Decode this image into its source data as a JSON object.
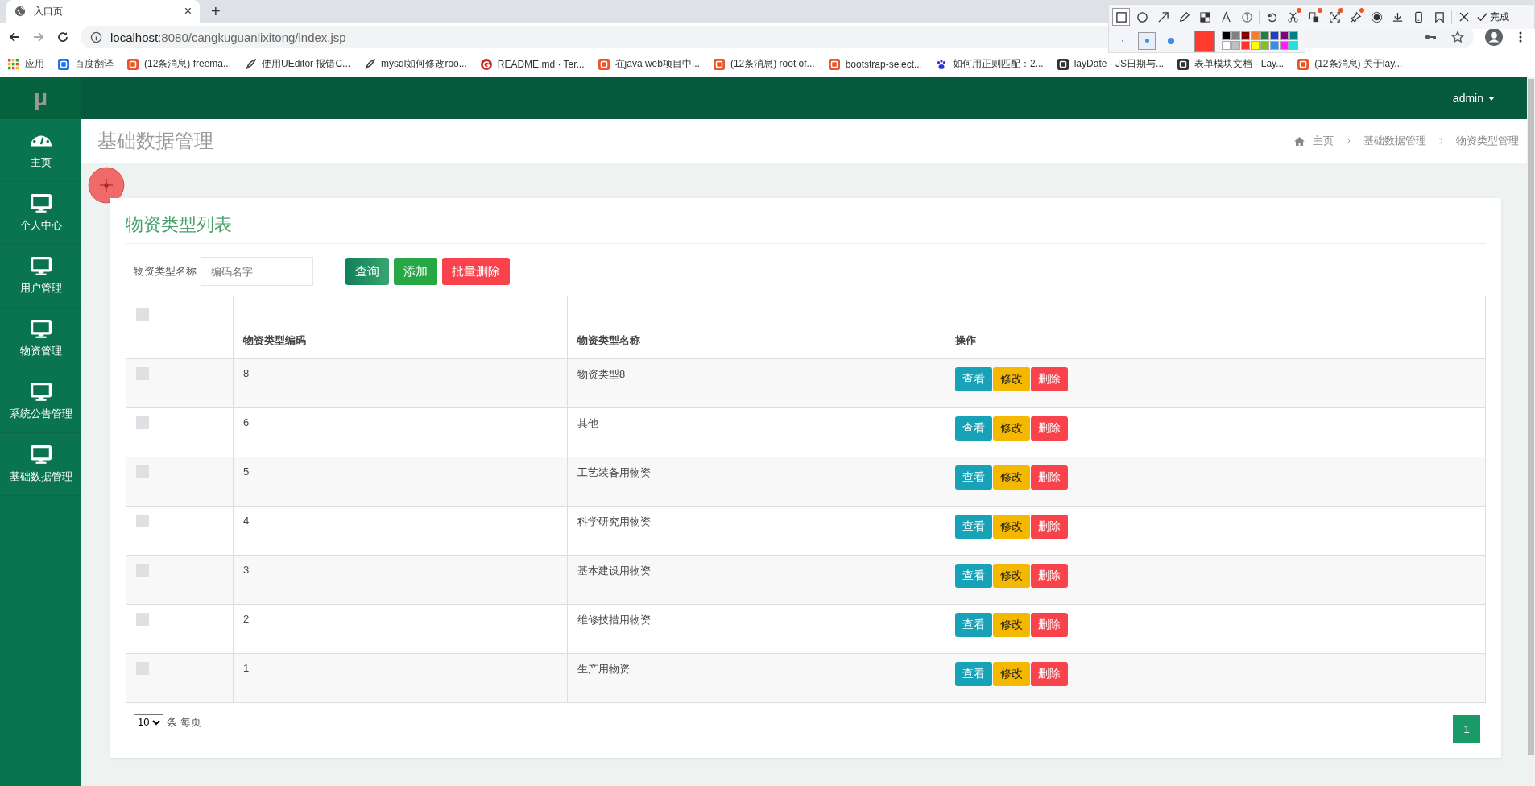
{
  "browser": {
    "tab": {
      "title": "入口页",
      "close": "×"
    },
    "new_tab": "+",
    "url": {
      "host": "localhost",
      "rest": ":8080/cangkuguanlixitong/index.jsp"
    },
    "bookmarks": [
      {
        "kind": "apps",
        "label": "应用"
      },
      {
        "kind": "translate",
        "label": "百度翻译"
      },
      {
        "kind": "c",
        "label": "(12条消息) freema..."
      },
      {
        "kind": "feather",
        "label": "使用UEditor 报错C..."
      },
      {
        "kind": "feather",
        "label": "mysql如何修改roo..."
      },
      {
        "kind": "g",
        "label": "README.md · Ter..."
      },
      {
        "kind": "c",
        "label": "在java web项目中..."
      },
      {
        "kind": "c",
        "label": "(12条消息) root of..."
      },
      {
        "kind": "jian",
        "label": "bootstrap-select..."
      },
      {
        "kind": "paw",
        "label": "如何用正则匹配：2..."
      },
      {
        "kind": "doc",
        "label": "layDate - JS日期与..."
      },
      {
        "kind": "doc",
        "label": "表单模块文档 - Lay..."
      },
      {
        "kind": "c",
        "label": "(12条消息) 关于lay..."
      }
    ]
  },
  "capture_toolbar": {
    "tools": [
      {
        "kind": "rectangle",
        "selected": true,
        "badge": false
      },
      {
        "kind": "circle",
        "selected": false,
        "badge": false
      },
      {
        "kind": "arrow",
        "selected": false,
        "badge": false
      },
      {
        "kind": "pencil",
        "selected": false,
        "badge": false
      },
      {
        "kind": "mosaic",
        "selected": false,
        "badge": false
      },
      {
        "kind": "text",
        "selected": false,
        "badge": false
      },
      {
        "kind": "number",
        "selected": false,
        "badge": false
      },
      {
        "kind": "undo",
        "selected": false,
        "badge": false
      },
      {
        "kind": "scissors",
        "selected": false,
        "badge": true
      },
      {
        "kind": "translate",
        "selected": false,
        "badge": true
      },
      {
        "kind": "scan",
        "selected": false,
        "badge": true
      },
      {
        "kind": "pin",
        "selected": false,
        "badge": true
      },
      {
        "kind": "record",
        "selected": false,
        "badge": false
      },
      {
        "kind": "download",
        "selected": false,
        "badge": false
      },
      {
        "kind": "phone",
        "selected": false,
        "badge": false
      },
      {
        "kind": "bookmark",
        "selected": false,
        "badge": false
      }
    ],
    "done": "完成",
    "sizes": [
      {
        "selected": false
      },
      {
        "selected": true
      },
      {
        "selected": false
      }
    ],
    "current_swatch": {
      "color": "#ff3b30"
    },
    "swatches": [
      {
        "color": "#000000"
      },
      {
        "color": "#808080"
      },
      {
        "color": "#800000"
      },
      {
        "color": "#f08030"
      },
      {
        "color": "#208040"
      },
      {
        "color": "#2040c0"
      },
      {
        "color": "#800080"
      },
      {
        "color": "#008080"
      },
      {
        "color": "#ffffff"
      },
      {
        "color": "#c0c0c0"
      },
      {
        "color": "#ff3030"
      },
      {
        "color": "#ffff00"
      },
      {
        "color": "#80c020"
      },
      {
        "color": "#3090f0"
      },
      {
        "color": "#ff20ff"
      },
      {
        "color": "#20e0e0"
      }
    ]
  },
  "app": {
    "logo": "μ",
    "user": "admin",
    "page_title": "基础数据管理",
    "breadcrumb": [
      "主页",
      "基础数据管理",
      "物资类型管理"
    ],
    "sidebar": [
      {
        "kind": "dashboard",
        "label": "主页"
      },
      {
        "kind": "monitor",
        "label": "个人中心"
      },
      {
        "kind": "monitor",
        "label": "用户管理"
      },
      {
        "kind": "monitor",
        "label": "物资管理"
      },
      {
        "kind": "monitor",
        "label": "系统公告管理"
      },
      {
        "kind": "monitor",
        "label": "基础数据管理"
      }
    ],
    "card_title": "物资类型列表",
    "search": {
      "label": "物资类型名称",
      "placeholder": "编码名字"
    },
    "toolbar_buttons": [
      {
        "kind": "search",
        "label": "查询"
      },
      {
        "kind": "add",
        "label": "添加"
      },
      {
        "kind": "delete",
        "label": "批量删除"
      }
    ],
    "table": {
      "header_checked": false,
      "columns": [
        "物资类型编码",
        "物资类型名称",
        "操作"
      ],
      "rows": [
        {
          "checked": false,
          "code": "8",
          "name": "物资类型8",
          "actions": [
            {
              "kind": "view",
              "label": "查看"
            },
            {
              "kind": "edit",
              "label": "修改"
            },
            {
              "kind": "delete",
              "label": "删除"
            }
          ]
        },
        {
          "checked": false,
          "code": "6",
          "name": "其他",
          "actions": [
            {
              "kind": "view",
              "label": "查看"
            },
            {
              "kind": "edit",
              "label": "修改"
            },
            {
              "kind": "delete",
              "label": "删除"
            }
          ]
        },
        {
          "checked": false,
          "code": "5",
          "name": "工艺装备用物资",
          "actions": [
            {
              "kind": "view",
              "label": "查看"
            },
            {
              "kind": "edit",
              "label": "修改"
            },
            {
              "kind": "delete",
              "label": "删除"
            }
          ]
        },
        {
          "checked": false,
          "code": "4",
          "name": "科学研究用物资",
          "actions": [
            {
              "kind": "view",
              "label": "查看"
            },
            {
              "kind": "edit",
              "label": "修改"
            },
            {
              "kind": "delete",
              "label": "删除"
            }
          ]
        },
        {
          "checked": false,
          "code": "3",
          "name": "基本建设用物资",
          "actions": [
            {
              "kind": "view",
              "label": "查看"
            },
            {
              "kind": "edit",
              "label": "修改"
            },
            {
              "kind": "delete",
              "label": "删除"
            }
          ]
        },
        {
          "checked": false,
          "code": "2",
          "name": "维修技措用物资",
          "actions": [
            {
              "kind": "view",
              "label": "查看"
            },
            {
              "kind": "edit",
              "label": "修改"
            },
            {
              "kind": "delete",
              "label": "删除"
            }
          ]
        },
        {
          "checked": false,
          "code": "1",
          "name": "生产用物资",
          "actions": [
            {
              "kind": "view",
              "label": "查看"
            },
            {
              "kind": "edit",
              "label": "修改"
            },
            {
              "kind": "delete",
              "label": "删除"
            }
          ]
        }
      ]
    },
    "page_size": "10",
    "page_size_suffix": "条 每页",
    "pages": [
      {
        "label": "1",
        "selected": true
      }
    ]
  }
}
